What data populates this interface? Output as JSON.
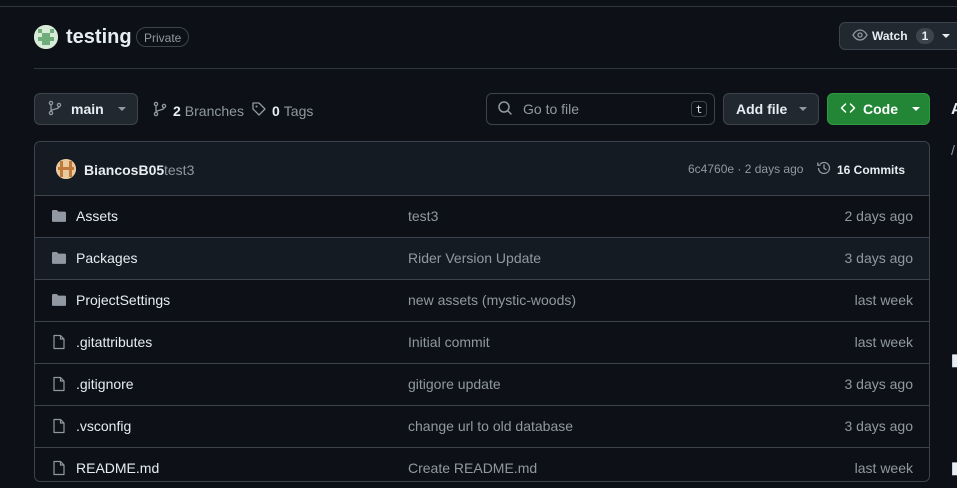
{
  "repo": {
    "name": "testing",
    "visibility": "Private"
  },
  "watch": {
    "label": "Watch",
    "count": "1"
  },
  "toolbar": {
    "branch": "main",
    "branches_count": "2",
    "branches_label": "Branches",
    "tags_count": "0",
    "tags_label": "Tags",
    "search_placeholder": "Go to file",
    "search_shortcut": "t",
    "add_file_label": "Add file",
    "code_label": "Code"
  },
  "latest_commit": {
    "author": "BiancosB05",
    "message": "test3",
    "hash_time": "6c4760e · 2 days ago",
    "commits_label": "16 Commits"
  },
  "files": [
    {
      "type": "folder",
      "name": "Assets",
      "message": "test3",
      "date": "2 days ago"
    },
    {
      "type": "folder",
      "name": "Packages",
      "message": "Rider Version Update",
      "date": "3 days ago"
    },
    {
      "type": "folder",
      "name": "ProjectSettings",
      "message": "new assets (mystic-woods)",
      "date": "last week"
    },
    {
      "type": "file",
      "name": ".gitattributes",
      "message": "Initial commit",
      "date": "last week"
    },
    {
      "type": "file",
      "name": ".gitignore",
      "message": "gitigore update",
      "date": "3 days ago"
    },
    {
      "type": "file",
      "name": ".vsconfig",
      "message": "change url to old database",
      "date": "3 days ago"
    },
    {
      "type": "file",
      "name": "README.md",
      "message": "Create README.md",
      "date": "last week"
    }
  ],
  "colors": {
    "background": "#0d1117",
    "border": "#3d444d",
    "accent_green": "#238636",
    "muted": "#9198a1"
  }
}
